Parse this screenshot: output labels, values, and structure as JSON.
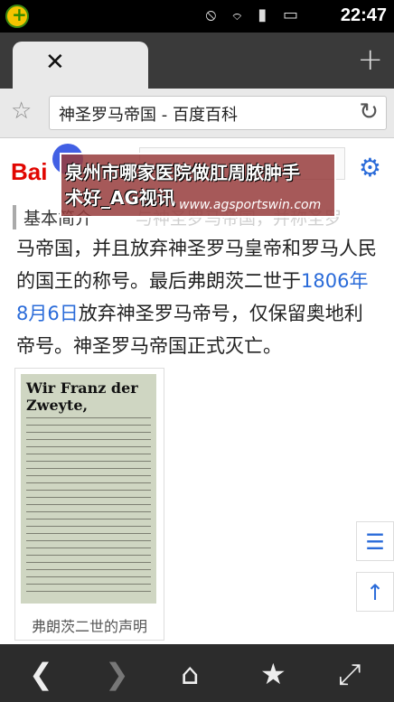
{
  "status": {
    "time": "22:47",
    "icons": "⦸ ⌔ ▮ ▭"
  },
  "tabs": {
    "close_glyph": "✕",
    "new_tab_glyph": "+"
  },
  "address": {
    "title": "神圣罗马帝国 - 百度百科",
    "star_glyph": "☆",
    "reload_glyph": "↻"
  },
  "page": {
    "logo": "Bai",
    "settings_glyph": "⚙",
    "section_title": "基本简介",
    "ghost_text": "与神圣罗马帝国，并称圣罗",
    "overlay": {
      "line1": "泉州市哪家医院做肛周脓肿手",
      "line2": "术好_AG视讯",
      "url": "www.agsportswin.com"
    },
    "body_part1": "马帝国，并且放弃神圣罗马皇帝和罗马人民的国王的称号。最后弗朗茨二世于",
    "body_link": "1806年8月6日",
    "body_part2": "放弃神圣罗马帝号，仅保留奥地利帝号。神圣罗马帝国正式灭亡。",
    "figure_heading": "Wir Franz der Zweyte,",
    "figure_caption": "弗朗茨二世的声明",
    "side_list_glyph": "☰",
    "side_top_glyph": "↑"
  },
  "toolbar": {
    "back": "❮",
    "forward": "❯",
    "home": "⌂",
    "bookmarks": "★",
    "fullscreen": "⤢"
  }
}
